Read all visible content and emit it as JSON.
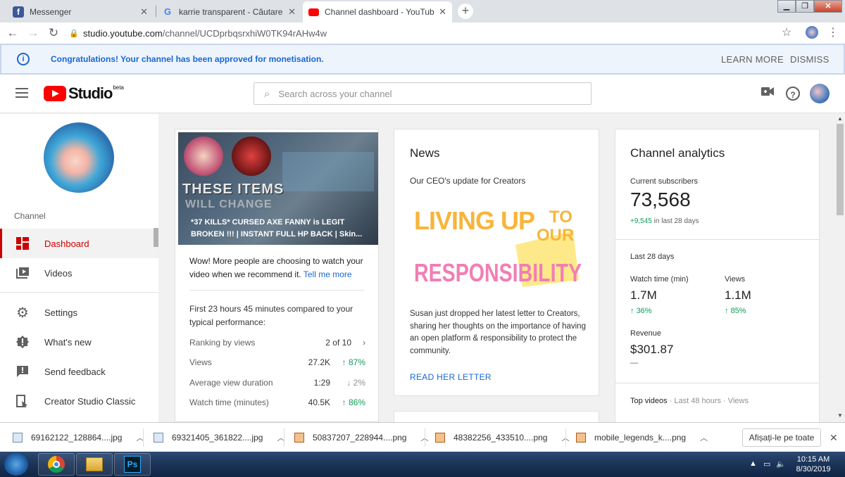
{
  "browser": {
    "tabs": [
      {
        "title": "Messenger",
        "icon": "facebook-icon",
        "color": "#3b5998"
      },
      {
        "title": "karrie transparent - Căutare Goo",
        "icon": "google-icon",
        "color": "#4285f4"
      },
      {
        "title": "Channel dashboard - YouTube St",
        "icon": "youtube-icon",
        "color": "#ff0000"
      }
    ],
    "url_host": "studio.youtube.com",
    "url_path": "/channel/UCDprbqsrxhiW0TK94rAHw4w"
  },
  "banner": {
    "message": "Congratulations! Your channel has been approved for monetisation.",
    "learn_more": "LEARN MORE",
    "dismiss": "DISMISS"
  },
  "header": {
    "logo_text": "Studio",
    "logo_beta": "beta",
    "search_placeholder": "Search across your channel"
  },
  "sidebar": {
    "channel_label": "Channel",
    "items": [
      {
        "label": "Dashboard",
        "icon": "dashboard-icon",
        "active": true
      },
      {
        "label": "Videos",
        "icon": "videos-icon"
      },
      {
        "label": "Settings",
        "icon": "gear-icon"
      },
      {
        "label": "What's new",
        "icon": "alert-icon"
      },
      {
        "label": "Send feedback",
        "icon": "feedback-icon"
      },
      {
        "label": "Creator Studio Classic",
        "icon": "classic-icon"
      }
    ]
  },
  "video_card": {
    "thumb_text_1": "THESE ITEMS",
    "thumb_text_2": "WILL CHANGE",
    "title": "*37 KILLS* CURSED AXE FANNY is LEGIT BROKEN !!! | INSTANT FULL HP BACK | Skin...",
    "promo_text": "Wow! More people are choosing to watch your video when we recommend it.",
    "promo_link": "Tell me more",
    "compare_text": "First 23 hours 45 minutes compared to your typical performance:",
    "stats": [
      {
        "label": "Ranking by views",
        "value": "2 of 10",
        "delta": ""
      },
      {
        "label": "Views",
        "value": "27.2K",
        "delta": "87%",
        "dir": "up"
      },
      {
        "label": "Average view duration",
        "value": "1:29",
        "delta": "2%",
        "dir": "down"
      },
      {
        "label": "Watch time (minutes)",
        "value": "40.5K",
        "delta": "86%",
        "dir": "up"
      }
    ]
  },
  "news_card": {
    "title": "News",
    "subtitle": "Our CEO's update for Creators",
    "image_line1": "LIVING UP",
    "image_to": "TO",
    "image_our": "OUR",
    "image_line2": "RESPONSIBILITY",
    "body": "Susan just dropped her latest letter to Creators, sharing her thoughts on the importance of having an open platform & responsibility to protect the community.",
    "link": "READ HER LETTER"
  },
  "analytics_card": {
    "title": "Channel analytics",
    "subs_label": "Current subscribers",
    "subs_value": "73,568",
    "subs_gain": "+9,545",
    "subs_gain_suffix": "in last 28 days",
    "period": "Last 28 days",
    "watch_label": "Watch time (min)",
    "watch_value": "1.7M",
    "watch_pct": "36%",
    "views_label": "Views",
    "views_value": "1.1M",
    "views_pct": "85%",
    "revenue_label": "Revenue",
    "revenue_value": "$301.87",
    "revenue_delta": "—",
    "top_videos": "Top videos",
    "top_videos_meta": "· Last 48 hours · Views"
  },
  "downloads": {
    "items": [
      {
        "name": "69162122_128864....jpg",
        "type": "jpg"
      },
      {
        "name": "69321405_361822....jpg",
        "type": "jpg"
      },
      {
        "name": "50837207_228944....png",
        "type": "png"
      },
      {
        "name": "48382256_433510....png",
        "type": "png"
      },
      {
        "name": "mobile_legends_k....png",
        "type": "png"
      }
    ],
    "show_all": "Afișați-le pe toate"
  },
  "taskbar": {
    "time": "10:15 AM",
    "date": "8/30/2019",
    "ps_label": "Ps"
  },
  "colors": {
    "accent_red": "#cc0000",
    "link_blue": "#1967d2",
    "positive_green": "#0f9d58"
  }
}
